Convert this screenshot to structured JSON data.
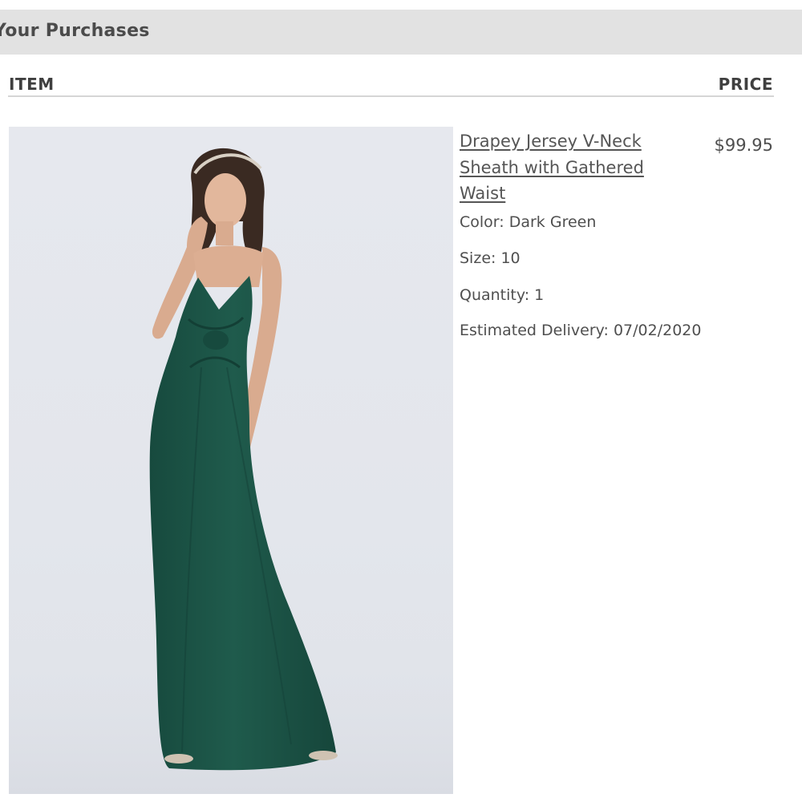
{
  "header": {
    "title": "Your Purchases"
  },
  "table": {
    "columns": {
      "item": "ITEM",
      "price": "PRICE"
    }
  },
  "items": [
    {
      "name": "Drapey Jersey V-Neck Sheath with Gathered Waist",
      "name_lines": [
        "Drapey Jersey V-Neck",
        "Sheath with Gathered",
        "Waist"
      ],
      "price": "$99.95",
      "color_line": "Color: Dark Green",
      "size_line": "Size: 10",
      "quantity_line": "Quantity: 1",
      "delivery_line": "Estimated Delivery: 07/02/2020",
      "image": {
        "icon": "product-photo",
        "dress_color": "#1f5b4c"
      }
    }
  ]
}
